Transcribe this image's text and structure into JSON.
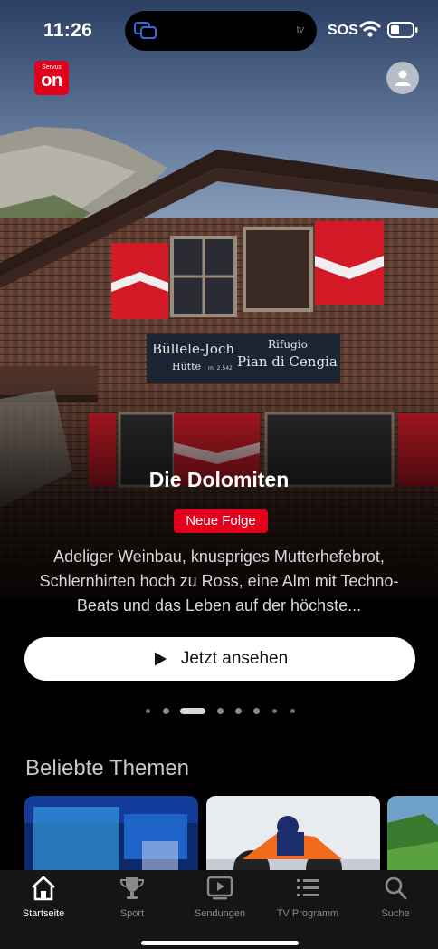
{
  "status_bar": {
    "time": "11:26",
    "island_label": "tv",
    "sos": "SOS",
    "icons": [
      "screen-mirroring-icon",
      "wifi-icon",
      "battery-icon"
    ]
  },
  "header": {
    "logo_small": "Servus",
    "logo_main": "on",
    "profile_icon": "person-icon",
    "brand_color": "#e3001b"
  },
  "hero": {
    "title": "Die Dolomiten",
    "badge": "Neue Folge",
    "description": "Adeliger Weinbau, knuspriges Mutterhefebrot, Schlernhirten hoch zu Ross, eine Alm mit Techno-Beats und das Leben auf der höchste...",
    "cta_label": "Jetzt ansehen",
    "sign": {
      "line1": "Büllele-Joch",
      "line2": "Hütte",
      "line3": "m. 2.542",
      "line4": "Rifugio",
      "line5": "Pian di Cengia"
    },
    "pager": {
      "count": 8,
      "active_index": 2
    }
  },
  "section": {
    "title": "Beliebte Themen"
  },
  "tabs": [
    {
      "label": "Startseite",
      "icon": "home-icon",
      "active": true
    },
    {
      "label": "Sport",
      "icon": "trophy-icon",
      "active": false
    },
    {
      "label": "Sendungen",
      "icon": "play-box-icon",
      "active": false
    },
    {
      "label": "TV Programm",
      "icon": "list-icon",
      "active": false
    },
    {
      "label": "Suche",
      "icon": "search-icon",
      "active": false
    }
  ]
}
